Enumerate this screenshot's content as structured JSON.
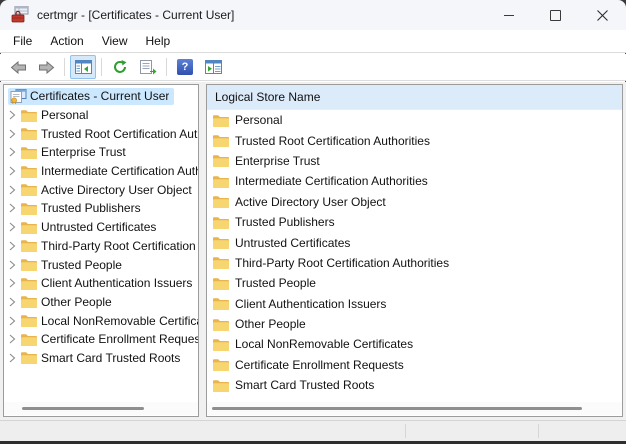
{
  "window": {
    "title": "certmgr - [Certificates - Current User]",
    "controls": {
      "minimize": "minimize-window",
      "maximize": "maximize-window",
      "close": "close-window"
    }
  },
  "menu": {
    "items": [
      {
        "label": "File"
      },
      {
        "label": "Action"
      },
      {
        "label": "View"
      },
      {
        "label": "Help"
      }
    ]
  },
  "toolbar": {
    "buttons": [
      "back",
      "forward",
      "show-hide-console-tree",
      "refresh",
      "export-list",
      "help",
      "show-hide-action-pane"
    ],
    "active_button": "show-hide-console-tree",
    "help_glyph": "?"
  },
  "tree": {
    "root": "Certificates - Current User",
    "items": [
      "Personal",
      "Trusted Root Certification Authorities",
      "Enterprise Trust",
      "Intermediate Certification Authorities",
      "Active Directory User Object",
      "Trusted Publishers",
      "Untrusted Certificates",
      "Third-Party Root Certification Authorities",
      "Trusted People",
      "Client Authentication Issuers",
      "Other People",
      "Local NonRemovable Certificates",
      "Certificate Enrollment Requests",
      "Smart Card Trusted Roots"
    ]
  },
  "list": {
    "header": "Logical Store Name",
    "items": [
      "Personal",
      "Trusted Root Certification Authorities",
      "Enterprise Trust",
      "Intermediate Certification Authorities",
      "Active Directory User Object",
      "Trusted Publishers",
      "Untrusted Certificates",
      "Third-Party Root Certification Authorities",
      "Trusted People",
      "Client Authentication Issuers",
      "Other People",
      "Local NonRemovable Certificates",
      "Certificate Enrollment Requests",
      "Smart Card Trusted Roots"
    ]
  },
  "colors": {
    "selection_highlight": "#cce8ff",
    "list_header_bg": "#dcebf9",
    "folder_front": "#f7d571",
    "folder_back": "#e8b44c",
    "toolbar_active_bg": "#d7e9f9",
    "toolbar_active_border": "#8fc2ee",
    "help_blue": "#2e50ad",
    "titlebar_bg": "#f5f6fa"
  }
}
